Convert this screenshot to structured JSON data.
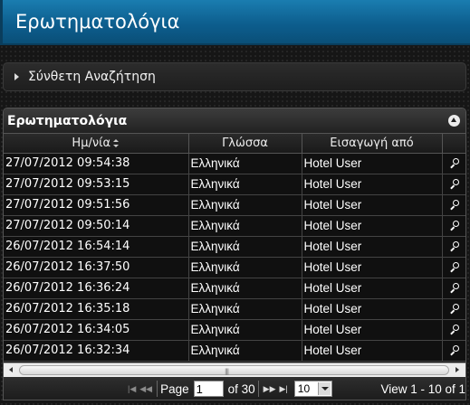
{
  "window": {
    "title": "Ερωτηματολόγια"
  },
  "search": {
    "label": "Σύνθετη Αναζήτηση"
  },
  "grid": {
    "caption": "Ερωτηματολόγια",
    "columns": [
      "Ημ/νία",
      "Γλώσσα",
      "Εισαγωγή από",
      ""
    ],
    "rows": [
      {
        "date": "27/07/2012 09:54:38",
        "language": "Ελληνικά",
        "entered_by": "Hotel User"
      },
      {
        "date": "27/07/2012 09:53:15",
        "language": "Ελληνικά",
        "entered_by": "Hotel User"
      },
      {
        "date": "27/07/2012 09:51:56",
        "language": "Ελληνικά",
        "entered_by": "Hotel User"
      },
      {
        "date": "27/07/2012 09:50:14",
        "language": "Ελληνικά",
        "entered_by": "Hotel User"
      },
      {
        "date": "26/07/2012 16:54:14",
        "language": "Ελληνικά",
        "entered_by": "Hotel User"
      },
      {
        "date": "26/07/2012 16:37:50",
        "language": "Ελληνικά",
        "entered_by": "Hotel User"
      },
      {
        "date": "26/07/2012 16:36:24",
        "language": "Ελληνικά",
        "entered_by": "Hotel User"
      },
      {
        "date": "26/07/2012 16:35:18",
        "language": "Ελληνικά",
        "entered_by": "Hotel User"
      },
      {
        "date": "26/07/2012 16:34:05",
        "language": "Ελληνικά",
        "entered_by": "Hotel User"
      },
      {
        "date": "26/07/2012 16:32:34",
        "language": "Ελληνικά",
        "entered_by": "Hotel User"
      }
    ]
  },
  "pager": {
    "page_label": "Page",
    "page_value": "1",
    "of_label": "of 30",
    "rows_per_page": "10",
    "view_text": "View 1 - 10 of 1"
  },
  "colors": {
    "title_bar": "#0d5e8e",
    "background": "#161616"
  }
}
